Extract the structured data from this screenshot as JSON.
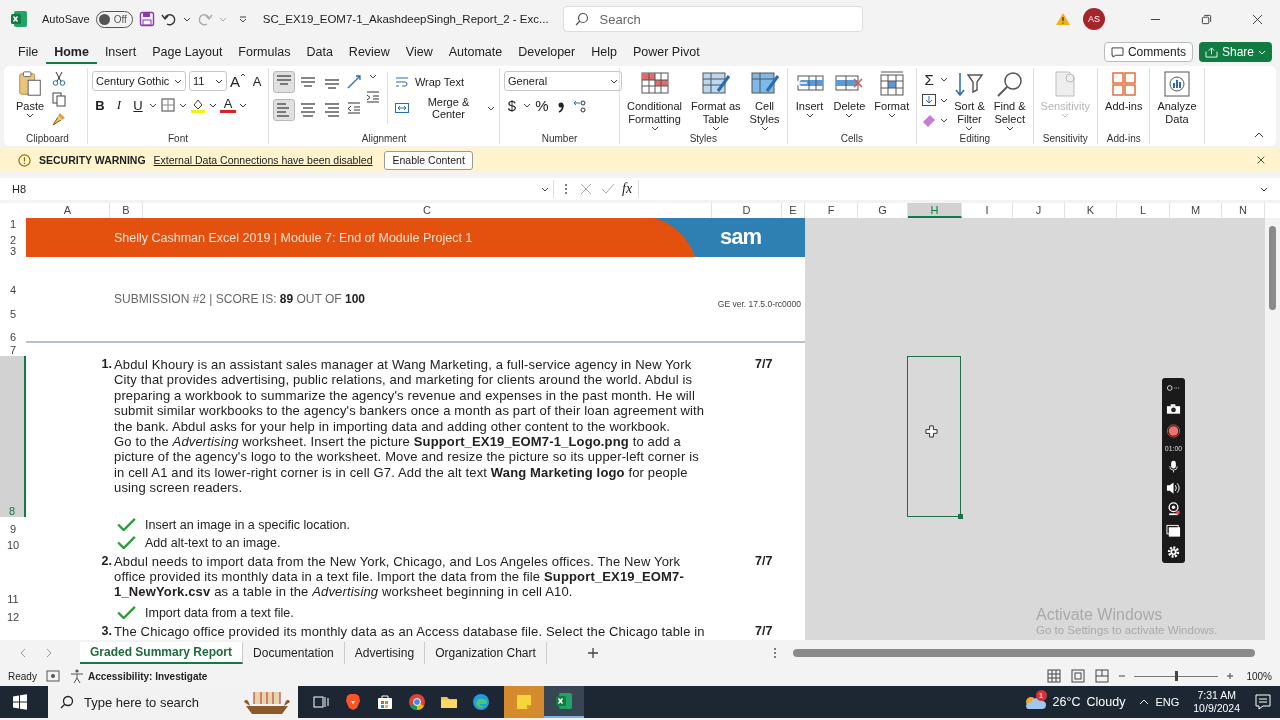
{
  "title_bar": {
    "autosave_label": "AutoSave",
    "autosave": {
      "label": "Off",
      "on": false
    },
    "filename": "SC_EX19_EOM7-1_AkashdeepSingh_Report_2  -  Exc...",
    "search_placeholder": "Search",
    "avatar": "AS"
  },
  "menu_tabs": [
    {
      "label": "File",
      "selected": false
    },
    {
      "label": "Home",
      "selected": true
    },
    {
      "label": "Insert",
      "selected": false
    },
    {
      "label": "Page Layout",
      "selected": false
    },
    {
      "label": "Formulas",
      "selected": false
    },
    {
      "label": "Data",
      "selected": false
    },
    {
      "label": "Review",
      "selected": false
    },
    {
      "label": "View",
      "selected": false
    },
    {
      "label": "Automate",
      "selected": false
    },
    {
      "label": "Developer",
      "selected": false
    },
    {
      "label": "Help",
      "selected": false
    },
    {
      "label": "Power Pivot",
      "selected": false
    }
  ],
  "comments": "Comments",
  "share": "Share",
  "ribbon": {
    "clipboard": {
      "label": "Clipboard",
      "paste": "Paste"
    },
    "font": {
      "label": "Font",
      "family": "Century Gothic",
      "size": "11",
      "grow": "A",
      "shrink": "A",
      "bold": "B",
      "italic": "I",
      "underline": "U",
      "font_color": "A"
    },
    "alignment": {
      "label": "Alignment",
      "wrap_text": "Wrap Text",
      "merge_center": "Merge & Center",
      "align_buttons": [
        {
          "kind": "top",
          "selected": true
        },
        {
          "kind": "middle",
          "selected": false
        },
        {
          "kind": "bottom",
          "selected": false
        },
        {
          "kind": "left",
          "selected": true
        },
        {
          "kind": "center",
          "selected": false
        },
        {
          "kind": "right",
          "selected": false
        }
      ]
    },
    "number": {
      "label": "Number",
      "format": "General",
      "currency": "$",
      "percent": "%"
    },
    "styles": {
      "label": "Styles",
      "buttons": [
        {
          "label": "Conditional\nFormatting",
          "kind": "conditional",
          "menu": true,
          "disabled": false
        },
        {
          "label": "Format as\nTable",
          "kind": "table",
          "menu": true,
          "disabled": false
        },
        {
          "label": "Cell\nStyles",
          "kind": "styles",
          "menu": true,
          "disabled": false
        }
      ]
    },
    "cells": {
      "label": "Cells",
      "buttons": [
        {
          "label": "Insert",
          "kind": "insert",
          "menu": true,
          "disabled": false
        },
        {
          "label": "Delete",
          "kind": "delete",
          "menu": true,
          "disabled": false
        },
        {
          "label": "Format",
          "kind": "format",
          "menu": true,
          "disabled": false
        }
      ]
    },
    "editing": {
      "label": "Editing",
      "sum": "Σ",
      "buttons": [
        {
          "label": "Sort &\nFilter",
          "kind": "sort",
          "menu": true,
          "disabled": false
        },
        {
          "label": "Find &\nSelect",
          "kind": "find",
          "menu": true,
          "disabled": false
        }
      ]
    },
    "sensitivity": {
      "label": "Sensitivity",
      "buttons": [
        {
          "label": "Sensitivity",
          "kind": "sensitivity",
          "menu": true,
          "disabled": true
        }
      ]
    },
    "addins": {
      "label": "Add-ins",
      "buttons": [
        {
          "label": "Add-ins",
          "kind": "addins",
          "menu": false,
          "disabled": false
        }
      ]
    },
    "analyze": {
      "buttons": [
        {
          "label": "Analyze\nData",
          "kind": "analyze",
          "menu": false,
          "disabled": false
        }
      ]
    }
  },
  "security_bar": {
    "title": "SECURITY WARNING",
    "message": "External Data Connections have been disabled",
    "button": "Enable Content"
  },
  "formula_bar": {
    "name_box": "H8",
    "fx": "fx"
  },
  "columns": [
    {
      "label": "A",
      "selected": false
    },
    {
      "label": "B",
      "selected": false
    },
    {
      "label": "C",
      "selected": false
    },
    {
      "label": "D",
      "selected": false
    },
    {
      "label": "E",
      "selected": false
    },
    {
      "label": "F",
      "selected": false
    },
    {
      "label": "G",
      "selected": false
    },
    {
      "label": "H",
      "selected": true
    },
    {
      "label": "I",
      "selected": false
    },
    {
      "label": "J",
      "selected": false
    },
    {
      "label": "K",
      "selected": false
    },
    {
      "label": "L",
      "selected": false
    },
    {
      "label": "M",
      "selected": false
    },
    {
      "label": "N",
      "selected": false
    }
  ],
  "rows": [
    {
      "label": "1",
      "selected": false
    },
    {
      "label": "2",
      "selected": false
    },
    {
      "label": "3",
      "selected": false
    },
    {
      "label": "4",
      "selected": false
    },
    {
      "label": "5",
      "selected": false
    },
    {
      "label": "6",
      "selected": false
    },
    {
      "label": "7",
      "selected": false
    },
    {
      "label": "8",
      "selected": true
    },
    {
      "label": "9",
      "selected": false
    },
    {
      "label": "10",
      "selected": false
    },
    {
      "label": "11",
      "selected": false
    },
    {
      "label": "12",
      "selected": false
    }
  ],
  "report": {
    "banner_title": "Shelly Cashman Excel 2019 | Module 7: End of Module Project 1",
    "logo": "sam",
    "submission": "SUBMISSION #2 | SCORE IS: **89** OUT OF **100**",
    "version": "GE ver. 17.5.0-rc0000",
    "tasks": [
      {
        "number": "1.",
        "text": "Abdul Khoury is an assistant sales manager at Wang Marketing, a full-service agency in New York City that provides advertising, public relations, and marketing for clients around the world. Abdul is preparing a workbook to summarize the agency's revenue and expenses in the past month. He will submit similar workbooks to the agency's bankers once a month as part of their loan agreement with the bank. Abdul asks for your help in importing data and adding other content to the workbook.\nGo to the *Advertising* worksheet. Insert the picture **Support_EX19_EOM7-1_Logo.png** to add a picture of the agency's logo to the worksheet. Move and resize the picture so its upper-left corner is in cell A1 and its lower-right corner is in cell G7. Add the alt text **Wang Marketing logo** for people using screen readers.",
        "score": "7/7",
        "checks": [
          {
            "text": "Insert an image in a specific location.",
            "checked": true
          },
          {
            "text": "Add alt-text to an image.",
            "checked": true
          }
        ]
      },
      {
        "number": "2.",
        "text": "Abdul needs to import data from the New York, Chicago, and Los Angeles offices. The New York office provided its monthly data in a text file. Import the data from the file **Support_EX19_EOM7-1_NewYork.csv** as a table in the *Advertising* worksheet beginning in cell A10.",
        "score": "7/7",
        "checks": [
          {
            "text": "Import data from a text file.",
            "checked": true
          }
        ]
      },
      {
        "number": "3.",
        "text": "The Chicago office provided its monthly data as an Access database file. Select the Chicago table in",
        "score": "7/7"
      }
    ]
  },
  "recorder": {
    "timer": "01:00"
  },
  "activation": {
    "title": "Activate Windows",
    "message": "Go to Settings to activate Windows."
  },
  "sheet_tabs": [
    {
      "label": "Graded Summary Report",
      "selected": true
    },
    {
      "label": "Documentation",
      "selected": false
    },
    {
      "label": "Advertising",
      "selected": false
    },
    {
      "label": "Organization Chart",
      "selected": false
    }
  ],
  "status_bar": {
    "mode": "Ready",
    "accessibility": "Accessibility: Investigate",
    "zoom": "100%",
    "zoom_slider": {
      "level": 0.5
    }
  },
  "taskbar": {
    "search_placeholder": "Type here to search",
    "weather_badge": "1",
    "temperature": "26°C",
    "weather": "Cloudy",
    "language": "ENG",
    "time": "7:31 AM",
    "date": "10/9/2024"
  }
}
